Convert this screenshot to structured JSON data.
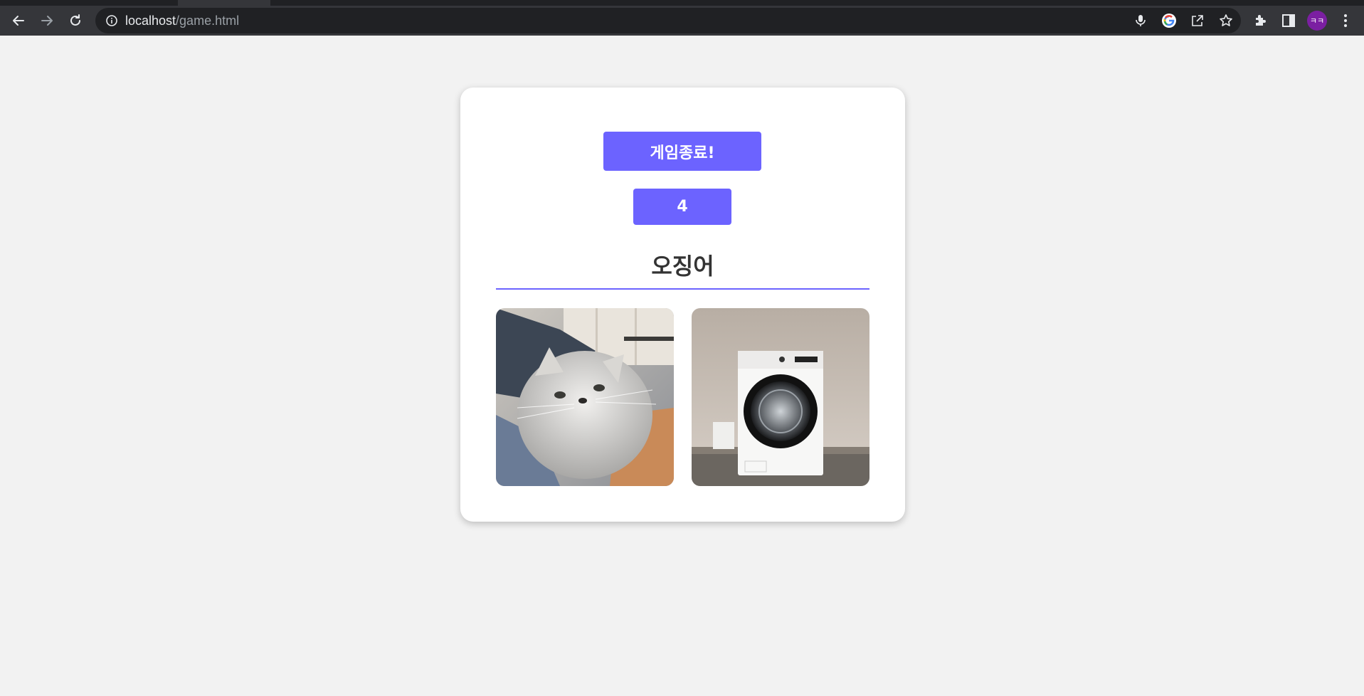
{
  "browser": {
    "url_host": "localhost",
    "url_path": "/game.html",
    "profile_initials": "ㅋㅋ"
  },
  "game": {
    "end_button_label": "게임종료!",
    "count": "4",
    "word": "오징어",
    "images": [
      {
        "subject": "cat"
      },
      {
        "subject": "washing-machine"
      }
    ]
  },
  "colors": {
    "accent": "#6c63ff",
    "background": "#f2f2f2",
    "card": "#ffffff"
  }
}
